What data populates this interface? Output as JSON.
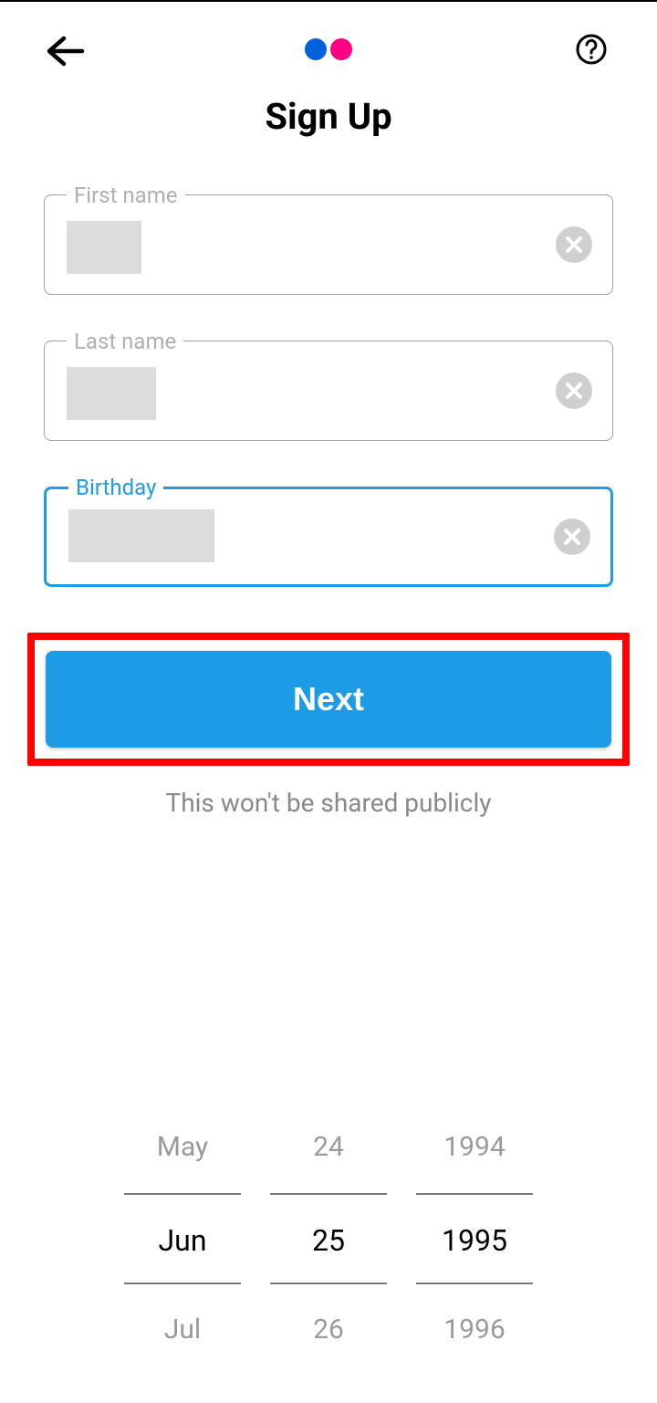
{
  "header": {
    "title": "Sign Up"
  },
  "fields": {
    "first_name": {
      "label": "First name"
    },
    "last_name": {
      "label": "Last name"
    },
    "birthday": {
      "label": "Birthday"
    }
  },
  "next_button": "Next",
  "privacy_note": "This won't be shared publicly",
  "date_picker": {
    "month": {
      "prev": "May",
      "selected": "Jun",
      "next": "Jul"
    },
    "day": {
      "prev": "24",
      "selected": "25",
      "next": "26"
    },
    "year": {
      "prev": "1994",
      "selected": "1995",
      "next": "1996"
    }
  }
}
